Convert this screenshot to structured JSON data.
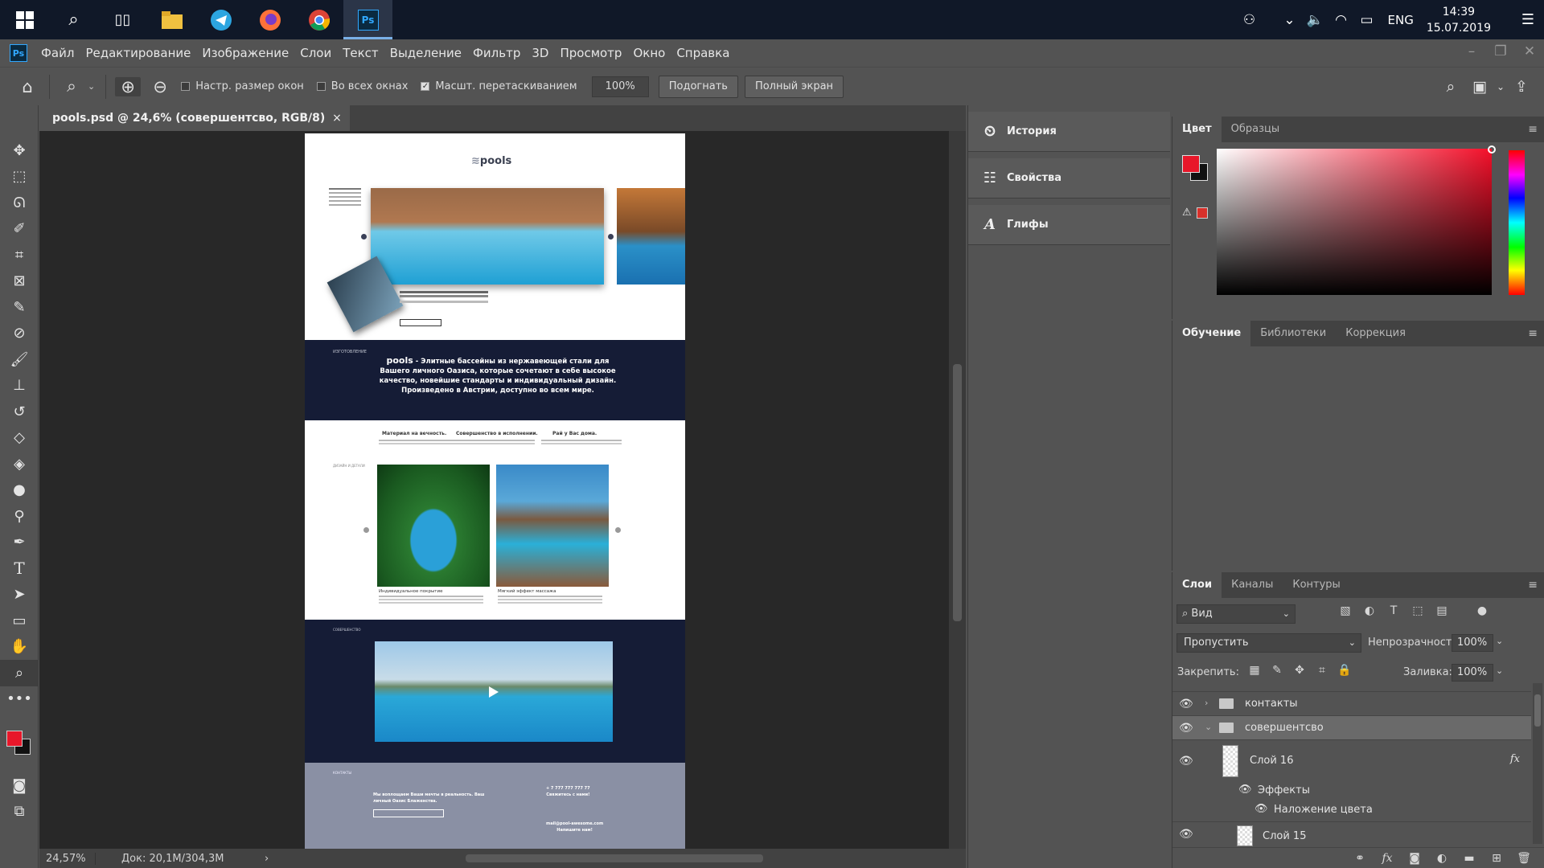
{
  "taskbar": {
    "tray_lang": "ENG",
    "time": "14:39",
    "date": "15.07.2019"
  },
  "menubar": {
    "app_icon": "Ps",
    "items": [
      "Файл",
      "Редактирование",
      "Изображение",
      "Слои",
      "Текст",
      "Выделение",
      "Фильтр",
      "3D",
      "Просмотр",
      "Окно",
      "Справка"
    ]
  },
  "options": {
    "resize_windows": "Настр. размер окон",
    "all_windows": "Во всех окнах",
    "scrubby_zoom": "Масшт. перетаскиванием",
    "zoom_value": "100%",
    "fit_button": "Подогнать",
    "fullscreen_button": "Полный экран",
    "resize_windows_checked": false,
    "all_windows_checked": false,
    "scrubby_zoom_checked": true
  },
  "document": {
    "tab_title": "pools.psd @ 24,6% (совершентсво, RGB/8)",
    "tab_close": "×",
    "page": {
      "logo": "pools",
      "band1_text_brand": "pools",
      "band1_text": "- Элитные бассейны из нержавеющей стали для Вашего личного Оазиса, которые сочетают в себе высокое качество, новейшие стандарты и индивидуальный дизайн. Произведено в Австрии, доступно во всем мире.",
      "feature_titles": [
        "Материал на вечность.",
        "Совершенство в исполнении.",
        "Рай у Вас дома."
      ],
      "feature_captions": [
        "Индивидуальное покрытие",
        "Мягкий эффект массажа"
      ],
      "contact_phone": "+ 7 777 777 777 77",
      "contact_cta": "Свяжитесь с нами!",
      "contact_email": "mail@pool-awesome.com",
      "contact_write": "Напишите нам!",
      "contact_left": "Мы воплощаем Ваши мечты в реальность. Ваш личный Оазис Блаженства."
    }
  },
  "status": {
    "zoom": "24,57%",
    "doc_info": "Док: 20,1M/304,3M"
  },
  "mid_panel": {
    "items": [
      {
        "label": "История",
        "icon": "history-icon"
      },
      {
        "label": "Свойства",
        "icon": "properties-icon"
      },
      {
        "label": "Глифы",
        "icon": "glyphs-icon"
      }
    ]
  },
  "color_panel": {
    "tabs": [
      "Цвет",
      "Образцы"
    ],
    "foreground": "#e8172a",
    "background": "#111111"
  },
  "learn_panel": {
    "tabs": [
      "Обучение",
      "Библиотеки",
      "Коррекция"
    ]
  },
  "layers_panel": {
    "tabs": [
      "Слои",
      "Каналы",
      "Контуры"
    ],
    "filter_placeholder": "Вид",
    "blend_mode": "Пропустить",
    "opacity_label": "Непрозрачность:",
    "opacity_value": "100%",
    "lock_label": "Закрепить:",
    "fill_label": "Заливка:",
    "fill_value": "100%",
    "layers": [
      {
        "name": "контакты",
        "type": "group",
        "expanded": false
      },
      {
        "name": "совершентсво",
        "type": "group",
        "expanded": true,
        "selected": true
      },
      {
        "name": "Слой 16",
        "type": "layer",
        "fx": "fx"
      },
      {
        "name": "Эффекты",
        "type": "effects"
      },
      {
        "name": "Наложение цвета",
        "type": "effect"
      },
      {
        "name": "Слой 15",
        "type": "layer"
      }
    ]
  }
}
